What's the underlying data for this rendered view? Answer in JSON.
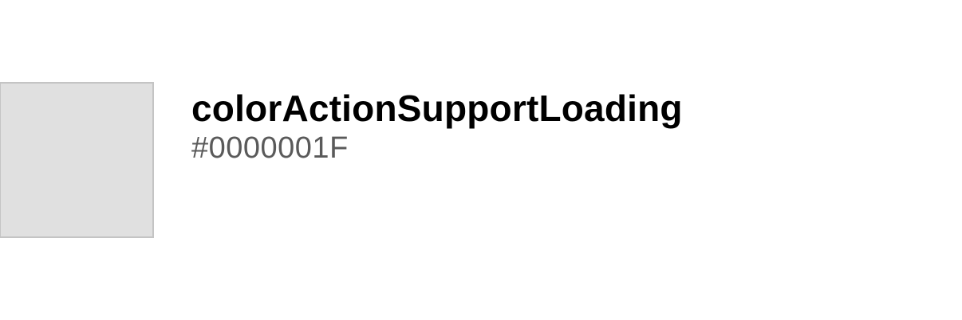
{
  "token": {
    "name": "colorActionSupportLoading",
    "value": "#0000001F",
    "swatch_color": "#0000001F",
    "swatch_border_color": "#c4c4c4",
    "swatch_rendered_color": "#e0e0e0"
  }
}
